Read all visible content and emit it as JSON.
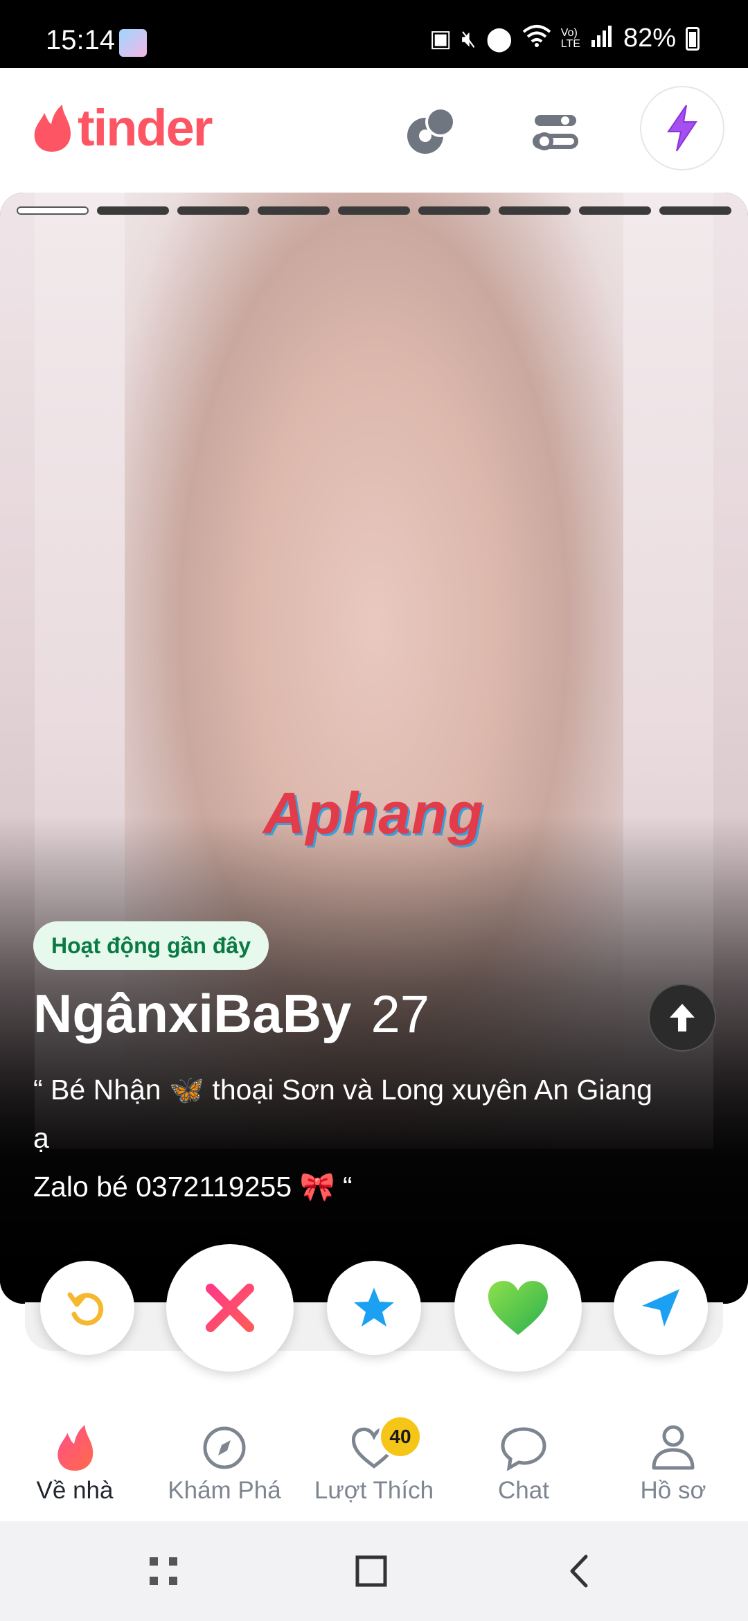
{
  "status_bar": {
    "time": "15:14",
    "battery": "82%",
    "icons": [
      "gallery-notification-icon",
      "battery-saver-icon",
      "mute-icon",
      "location-icon",
      "wifi-icon",
      "volte-icon",
      "signal-icon",
      "battery-icon"
    ]
  },
  "header": {
    "logo_text": "tinder",
    "brand_color": "#fd5564",
    "icons": [
      "double-date-icon",
      "filter-settings-icon",
      "boost-icon"
    ]
  },
  "card": {
    "photo_count": 9,
    "active_photo": 1,
    "watermark": "Aphang",
    "activity_badge": "Hoạt động gần đây",
    "name": "NgânxiBaBy",
    "age": "27",
    "bio_line1": "“ Bé Nhận 🦋 thoại Sơn và Long xuyên An Giang",
    "bio_line2": "ạ",
    "bio_line3": "Zalo bé 0372119255 🎀 “"
  },
  "actions": [
    "rewind-icon",
    "nope-icon",
    "super-like-icon",
    "like-icon",
    "boost-send-icon"
  ],
  "bottom_nav": {
    "items": [
      {
        "label": "Về nhà",
        "icon": "home-flame-icon",
        "active": true
      },
      {
        "label": "Khám Phá",
        "icon": "explore-compass-icon",
        "active": false
      },
      {
        "label": "Lượt Thích",
        "icon": "likes-heart-icon",
        "active": false,
        "badge": "40"
      },
      {
        "label": "Chat",
        "icon": "chat-bubble-icon",
        "active": false
      },
      {
        "label": "Hồ sơ",
        "icon": "profile-icon",
        "active": false
      }
    ]
  },
  "system_nav": [
    "recent-apps-icon",
    "home-square-icon",
    "back-icon"
  ]
}
